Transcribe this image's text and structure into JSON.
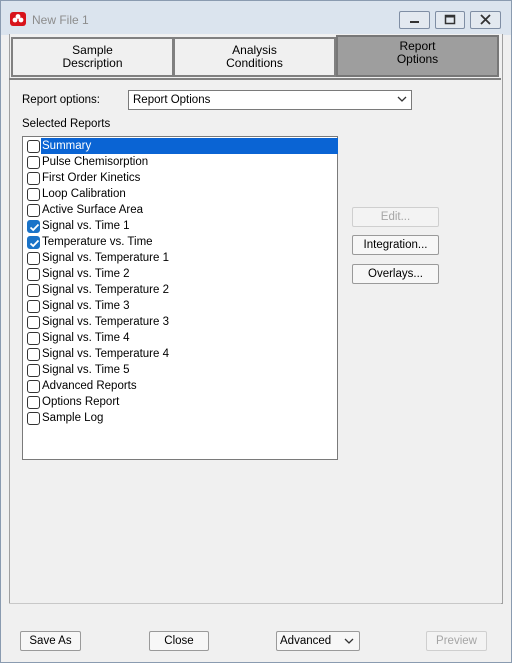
{
  "window": {
    "title": "New File 1"
  },
  "tabs": [
    {
      "label": "Sample\nDescription"
    },
    {
      "label": "Analysis\nConditions"
    },
    {
      "label": "Report\nOptions"
    }
  ],
  "report_options": {
    "label": "Report options:",
    "selected_value": "Report Options"
  },
  "selected_reports": {
    "label": "Selected Reports",
    "items": [
      {
        "label": "Summary",
        "checked": false,
        "selected": true
      },
      {
        "label": "Pulse Chemisorption",
        "checked": false
      },
      {
        "label": "First Order Kinetics",
        "checked": false
      },
      {
        "label": "Loop Calibration",
        "checked": false
      },
      {
        "label": "Active Surface Area",
        "checked": false
      },
      {
        "label": "Signal vs. Time 1",
        "checked": true
      },
      {
        "label": "Temperature vs. Time",
        "checked": true
      },
      {
        "label": "Signal vs. Temperature 1",
        "checked": false
      },
      {
        "label": "Signal vs. Time 2",
        "checked": false
      },
      {
        "label": "Signal vs. Temperature 2",
        "checked": false
      },
      {
        "label": "Signal vs. Time 3",
        "checked": false
      },
      {
        "label": "Signal vs. Temperature 3",
        "checked": false
      },
      {
        "label": "Signal vs. Time 4",
        "checked": false
      },
      {
        "label": "Signal vs. Temperature 4",
        "checked": false
      },
      {
        "label": "Signal vs. Time 5",
        "checked": false
      },
      {
        "label": "Advanced Reports",
        "checked": false
      },
      {
        "label": "Options Report",
        "checked": false
      },
      {
        "label": "Sample Log",
        "checked": false
      }
    ]
  },
  "side_buttons": {
    "edit": "Edit...",
    "integration": "Integration...",
    "overlays": "Overlays..."
  },
  "footer": {
    "save_as": "Save As",
    "close": "Close",
    "mode_value": "Advanced",
    "preview": "Preview"
  },
  "colors": {
    "selection": "#0a64d4",
    "checkbox_checked": "#1a73c8",
    "active_tab": "#9e9e9e"
  }
}
